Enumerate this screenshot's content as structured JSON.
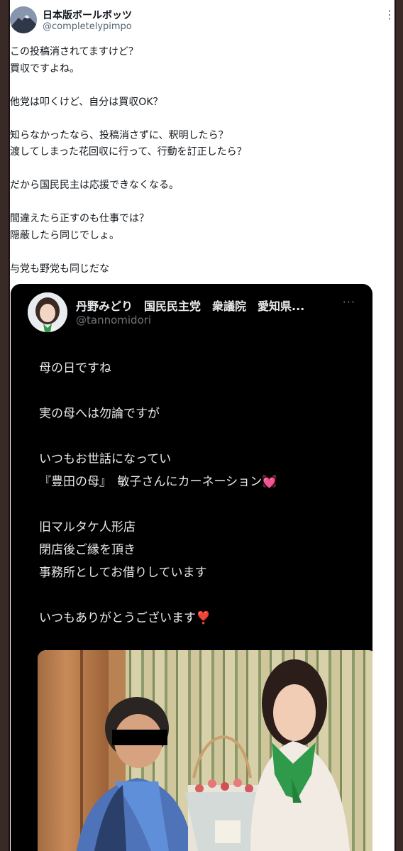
{
  "author": {
    "name": "日本版ボールボッツ",
    "handle": "@completelypimpo",
    "avatar_icon": "mountain-avatar-icon",
    "more_icon": "more-options-icon"
  },
  "post_lines": [
    "この投稿消されてますけど？",
    "買収ですよね。",
    "",
    "他党は叩くけど、自分は買収OK？",
    "",
    "知らなかったなら、投稿消さずに、釈明したら？",
    "渡してしまった花回収に行って、行動を訂正したら？",
    "",
    "だから国民民主は応援できなくなる。",
    "",
    "間違えたら正すのも仕事では？",
    "隠蔽したら同じでしょ。",
    "",
    "与党も野党も同じだな"
  ],
  "quoted": {
    "name": "丹野みどり　国民民主党　衆議院　愛知県...",
    "handle": "@tannomidori",
    "more_icon": "more-options-icon",
    "lines": [
      "母の日ですね",
      "",
      "実の母へは勿論ですが",
      "",
      "いつもお世話になってい",
      "『豊田の母』　敏子さんにカーネーション💓",
      "",
      "旧マルタケ人形店",
      "閉店後ご縁を頂き",
      "事務所としてお借りしています",
      "",
      "いつもありがとうございます❣️"
    ]
  },
  "colors": {
    "frame": "#3a2a27",
    "quote_bg": "#000000",
    "text_dark": "#0f1419",
    "text_muted": "#536471"
  }
}
